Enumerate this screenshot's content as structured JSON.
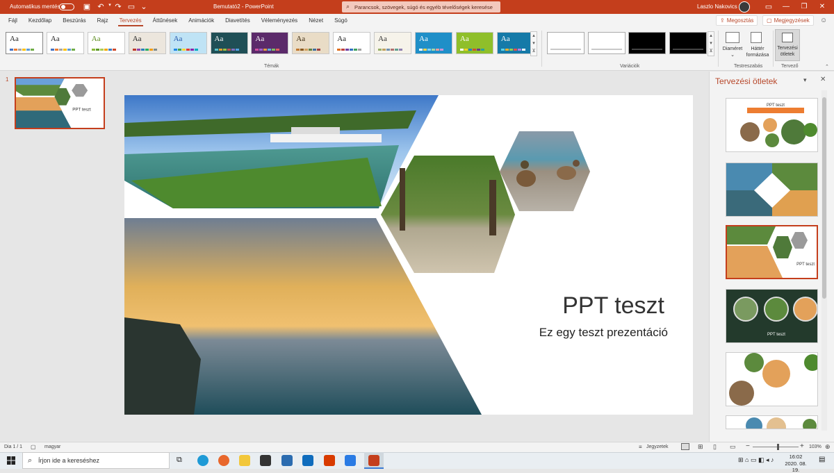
{
  "titlebar": {
    "autosave_label": "Automatikus mentés",
    "doc_title": "Bemutató2  -  PowerPoint",
    "search_text": "Parancsok, szövegek, súgó és egyéb tévelőségek keresése",
    "user_name": "Laszlo Nakovics",
    "minimize": "—",
    "restore": "❐",
    "close": "✕"
  },
  "tabs": [
    "Fájl",
    "Kezdőlap",
    "Beszúrás",
    "Rajz",
    "Tervezés",
    "Áttűnések",
    "Animációk",
    "Diavetítés",
    "Véleményezés",
    "Nézet",
    "Súgó"
  ],
  "active_tab": "Tervezés",
  "share_label": "Megosztás",
  "comments_label": "Megjegyzések",
  "ribbon": {
    "themes_group": "Témák",
    "variants_group": "Variációk",
    "customize_group": "Testreszabás",
    "designer_group": "Tervező",
    "slide_size": "Diaméret",
    "format_bg_1": "Háttér",
    "format_bg_2": "formázása",
    "design_ideas_1": "Tervezési",
    "design_ideas_2": "ötletek",
    "theme_label": "Aa",
    "themes": [
      {
        "bg": "#ffffff",
        "fg": "#222222",
        "bars": [
          "#4472c4",
          "#ed7d31",
          "#a5a5a5",
          "#ffc000",
          "#5b9bd5",
          "#70ad47"
        ]
      },
      {
        "bg": "#ffffff",
        "fg": "#222222",
        "bars": [
          "#4472c4",
          "#ed7d31",
          "#a5a5a5",
          "#ffc000",
          "#5b9bd5",
          "#70ad47"
        ]
      },
      {
        "bg": "#ffffff",
        "fg": "#5a8a1a",
        "bars": [
          "#8bb93a",
          "#5f9a2a",
          "#aacc55",
          "#f2a900",
          "#3a7ec8",
          "#d04a2a"
        ]
      },
      {
        "bg": "#ece6dd",
        "fg": "#222222",
        "bars": [
          "#c0392b",
          "#8e44ad",
          "#2980b9",
          "#27ae60",
          "#f39c12",
          "#7f8c8d"
        ]
      },
      {
        "bg": "#bfe3f5",
        "fg": "#2255aa",
        "bars": [
          "#1e88e5",
          "#43a047",
          "#fdd835",
          "#e53935",
          "#8e24aa",
          "#00acc1"
        ]
      },
      {
        "bg": "#1f4f56",
        "fg": "#ffffff",
        "bars": [
          "#58c0c8",
          "#e0a030",
          "#a0c040",
          "#c05050",
          "#8070c0",
          "#50a0e0"
        ]
      },
      {
        "bg": "#5b2a6a",
        "fg": "#ffffff",
        "bars": [
          "#d050a0",
          "#a060d0",
          "#e0a040",
          "#60b0e0",
          "#80c060",
          "#e06060"
        ]
      },
      {
        "bg": "#e9dcc6",
        "fg": "#3a2a10",
        "bars": [
          "#c07830",
          "#8a5a20",
          "#d0a060",
          "#608040",
          "#4070a0",
          "#a04040"
        ]
      },
      {
        "bg": "#ffffff",
        "fg": "#222222",
        "bars": [
          "#e07020",
          "#c04040",
          "#7040a0",
          "#3070c0",
          "#40a060",
          "#a0a0a0"
        ]
      },
      {
        "bg": "#f6f3ea",
        "fg": "#333333",
        "bars": [
          "#98b06a",
          "#c0a060",
          "#7090b0",
          "#b07070",
          "#60a090",
          "#9080b0"
        ]
      },
      {
        "bg": "#1f8fc8",
        "fg": "#ffffff",
        "bars": [
          "#ffffff",
          "#ffd54f",
          "#81d4fa",
          "#a5d6a7",
          "#ef9a9a",
          "#ce93d8"
        ]
      },
      {
        "bg": "#8fbf2a",
        "fg": "#ffffff",
        "bars": [
          "#ffffff",
          "#f2d024",
          "#2a7fbf",
          "#d0502a",
          "#6a3a8a",
          "#2aa09a"
        ]
      },
      {
        "bg": "#157aa8",
        "fg": "#ffffff",
        "bars": [
          "#5ad0e8",
          "#f0b030",
          "#90d050",
          "#e05050",
          "#b080e0",
          "#ffffff"
        ]
      }
    ],
    "variants": [
      {
        "bg": "#ffffff",
        "line": "#c9c9c9"
      },
      {
        "bg": "#ffffff",
        "line": "#c9c9c9"
      },
      {
        "bg": "#000000",
        "line": "#444444"
      },
      {
        "bg": "#000000",
        "line": "#444444"
      }
    ]
  },
  "slide": {
    "number": "1",
    "title": "PPT teszt",
    "subtitle": "Ez egy teszt prezentáció"
  },
  "design_ideas_pane": {
    "title": "Tervezési ötletek",
    "dropdown": "▾",
    "close": "✕",
    "idea1_title": "PPT teszt"
  },
  "statusbar": {
    "slide_count": "Dia 1 / 1",
    "language": "magyar",
    "notes_label": "Jegyzetek",
    "zoom": "103%",
    "zoom_fraction": 0.55
  },
  "taskbar": {
    "search_placeholder": "Írjon ide a kereséshez",
    "time": "16:02",
    "date": "2020. 08. 19."
  },
  "colors": {
    "accent": "#c43e1c",
    "accent_text": "#b7472a"
  }
}
